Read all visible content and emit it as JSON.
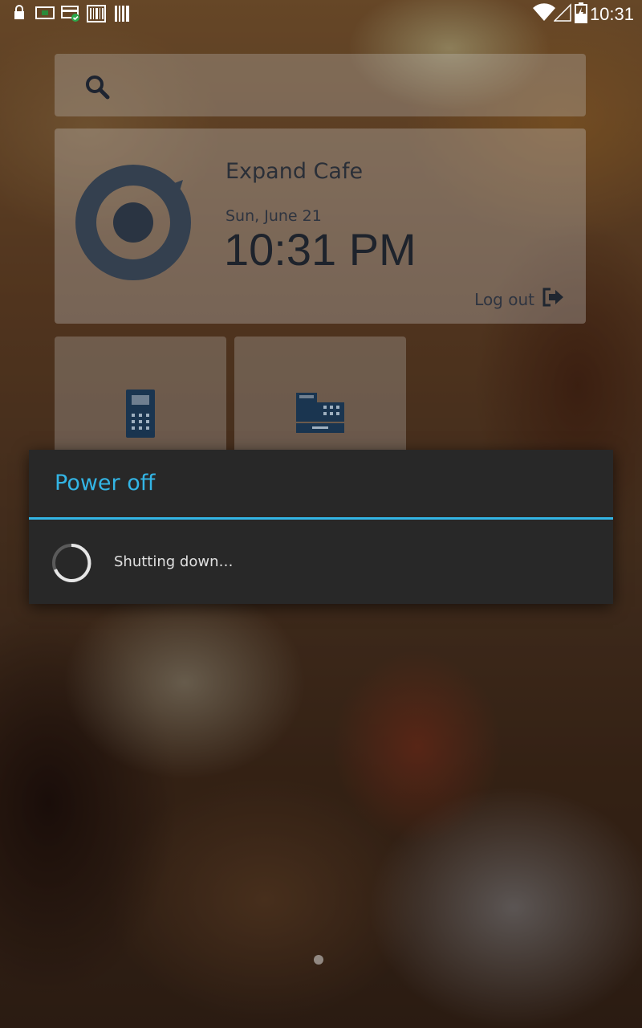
{
  "status_bar": {
    "time": "10:31",
    "left_icons": [
      "lock-icon",
      "screen-icon",
      "card-check-icon",
      "barcode-display-icon",
      "barcode-icon"
    ],
    "right_icons": [
      "wifi-icon",
      "signal-icon",
      "battery-charging-icon"
    ]
  },
  "search": {
    "icon": "search-icon"
  },
  "info_card": {
    "name": "Expand Cafe",
    "date": "Sun, June 21",
    "time": "10:31 PM",
    "logout_label": "Log out",
    "logout_icon": "logout-icon"
  },
  "tiles": [
    {
      "icon": "payment-terminal-icon"
    },
    {
      "icon": "cash-register-icon"
    }
  ],
  "dialog": {
    "title": "Power off",
    "message": "Shutting down…"
  },
  "colors": {
    "accent": "#33b5e5",
    "dialog_bg": "#282828",
    "icon_dark": "#1f2d3d"
  }
}
